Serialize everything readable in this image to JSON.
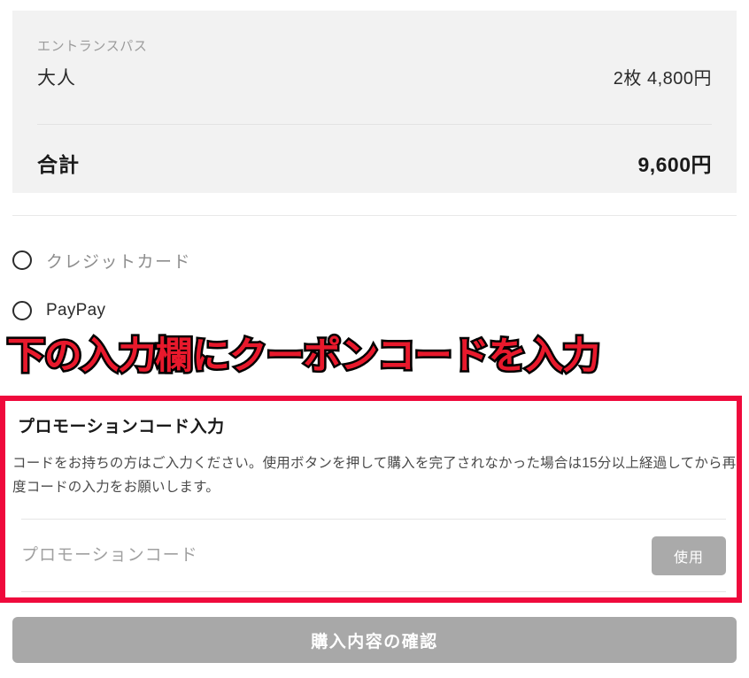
{
  "order_summary": {
    "item": {
      "category": "エントランスパス",
      "name": "大人",
      "price": "2枚 4,800円"
    },
    "total": {
      "label": "合計",
      "value": "9,600円"
    }
  },
  "payment": {
    "options": [
      {
        "label": "クレジットカード",
        "selected": false
      },
      {
        "label": "PayPay",
        "selected": false
      }
    ]
  },
  "annotation": {
    "text": "下の入力欄にクーポンコードを入力",
    "color": "#e8192c",
    "outline_color": "#000000"
  },
  "promotion": {
    "title": "プロモーションコード入力",
    "description": "コードをお持ちの方はご入力ください。使用ボタンを押して購入を完了されなかった場合は15分以上経過してから再度コードの入力をお願いします。",
    "input_placeholder": "プロモーションコード",
    "input_value": "",
    "apply_label": "使用",
    "highlight_color": "#ef0a3c"
  },
  "footer": {
    "confirm_label": "購入内容の確認"
  }
}
